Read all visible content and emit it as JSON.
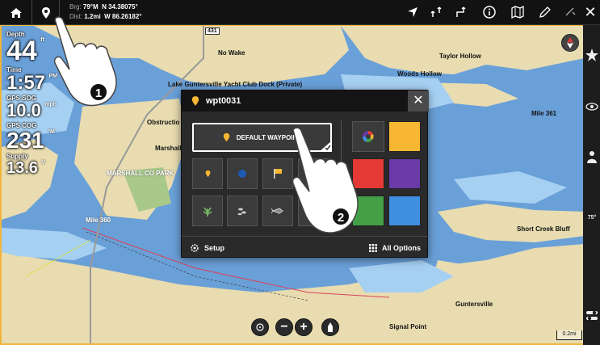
{
  "topbar": {
    "brg_label": "Brg:",
    "brg_value": "79°M",
    "dist_label": "Dist:",
    "dist_value": "1.2mi",
    "lat": "N 34.38075°",
    "lon": "W 86.26182°",
    "close_glyph": "✕"
  },
  "data_overlay": {
    "depth": {
      "label": "Depth",
      "value": "44",
      "unit": "ft"
    },
    "time": {
      "label": "Time",
      "value": "1:57",
      "unit": "PM"
    },
    "sog": {
      "label": "GPS SOG",
      "value": "10.0",
      "unit": "mph"
    },
    "cog": {
      "label": "GPS COG",
      "value": "231",
      "unit": "°M"
    },
    "supply": {
      "label": "Supply",
      "value": "13.6",
      "unit": "V"
    }
  },
  "map": {
    "labels": {
      "no_wake": "No Wake",
      "taylor_hollow": "Taylor Hollow",
      "woods_hollow": "Woods Hollow",
      "yacht_club": "Lake Guntersville Yacht Club Dock (Private)",
      "obstruction": "Obstructio",
      "marshall": "Marshall",
      "marshall_park": "MARSHALL CO PARK",
      "mile_361": "Mile 361",
      "mile_360": "Mile 360",
      "short_creek_bluff": "Short Creek Bluff",
      "guntersville": "Guntersville",
      "signal_point": "Signal Point",
      "marker_431": "431",
      "zoom_minus": "−",
      "zoom_plus": "+"
    },
    "scale": "0.2mi",
    "sidebar_badge": "75°"
  },
  "dialog": {
    "title": "wpt0031",
    "close_glyph": "✕",
    "default_label": "DEFAULT WAYPOINT",
    "setup_label": "Setup",
    "all_options_label": "All Options",
    "colors": [
      "#f7b733",
      "#e53935",
      "#6a3aa8",
      "#43a047",
      "#3f8fe0"
    ]
  },
  "callouts": {
    "one": "1",
    "two": "2"
  },
  "icons": [
    "home-icon",
    "pin-icon",
    "navigate-icon",
    "route-icon",
    "track-icon",
    "info-icon",
    "map-icon",
    "edit-icon",
    "settings-icon",
    "close-icon",
    "star-icon",
    "compass-icon",
    "gear-icon",
    "waypoint-icon",
    "circle-icon",
    "flag-icon",
    "fish-icon",
    "grid-icon"
  ]
}
